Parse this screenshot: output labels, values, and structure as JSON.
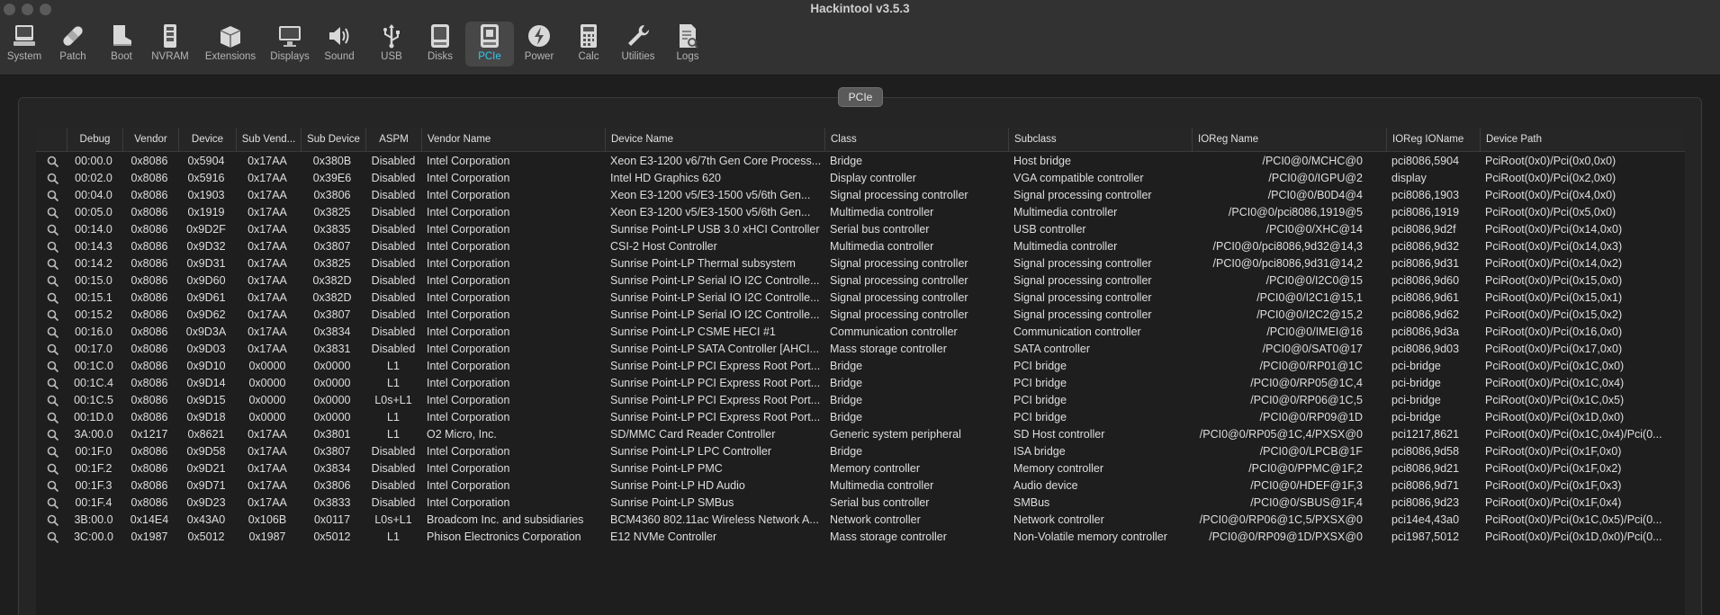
{
  "window": {
    "title": "Hackintool v3.5.3"
  },
  "toolbar": {
    "items": [
      {
        "id": "system",
        "label": "System",
        "icon": "computer-icon"
      },
      {
        "id": "patch",
        "label": "Patch",
        "icon": "bandage-icon"
      },
      {
        "id": "boot",
        "label": "Boot",
        "icon": "boot-icon"
      },
      {
        "id": "nvram",
        "label": "NVRAM",
        "icon": "memory-chip-icon"
      },
      {
        "id": "extensions",
        "label": "Extensions",
        "icon": "box-icon"
      },
      {
        "id": "displays",
        "label": "Displays",
        "icon": "display-icon"
      },
      {
        "id": "sound",
        "label": "Sound",
        "icon": "speaker-icon"
      },
      {
        "id": "usb",
        "label": "USB",
        "icon": "usb-icon"
      },
      {
        "id": "disks",
        "label": "Disks",
        "icon": "disk-icon"
      },
      {
        "id": "pcie",
        "label": "PCIe",
        "icon": "pcie-card-icon",
        "active": true
      },
      {
        "id": "power",
        "label": "Power",
        "icon": "power-bolt-icon"
      },
      {
        "id": "calc",
        "label": "Calc",
        "icon": "calculator-icon"
      },
      {
        "id": "utilities",
        "label": "Utilities",
        "icon": "wrench-icon"
      },
      {
        "id": "logs",
        "label": "Logs",
        "icon": "log-document-icon"
      }
    ]
  },
  "panel": {
    "title": "PCIe"
  },
  "table": {
    "columns": [
      "Debug",
      "Vendor",
      "Device",
      "Sub Vend...",
      "Sub Device",
      "ASPM",
      "Vendor Name",
      "Device Name",
      "Class",
      "Subclass",
      "IOReg Name",
      "IOReg IOName",
      "Device Path"
    ],
    "rows": [
      [
        "00:00.0",
        "0x8086",
        "0x5904",
        "0x17AA",
        "0x380B",
        "Disabled",
        "Intel Corporation",
        "Xeon E3-1200 v6/7th Gen Core Process...",
        "Bridge",
        "Host bridge",
        "/PCI0@0/MCHC@0",
        "pci8086,5904",
        "PciRoot(0x0)/Pci(0x0,0x0)"
      ],
      [
        "00:02.0",
        "0x8086",
        "0x5916",
        "0x17AA",
        "0x39E6",
        "Disabled",
        "Intel Corporation",
        "Intel HD Graphics 620",
        "Display controller",
        "VGA compatible controller",
        "/PCI0@0/IGPU@2",
        "display",
        "PciRoot(0x0)/Pci(0x2,0x0)"
      ],
      [
        "00:04.0",
        "0x8086",
        "0x1903",
        "0x17AA",
        "0x3806",
        "Disabled",
        "Intel Corporation",
        "Xeon E3-1200 v5/E3-1500 v5/6th Gen...",
        "Signal processing controller",
        "Signal processing controller",
        "/PCI0@0/B0D4@4",
        "pci8086,1903",
        "PciRoot(0x0)/Pci(0x4,0x0)"
      ],
      [
        "00:05.0",
        "0x8086",
        "0x1919",
        "0x17AA",
        "0x3825",
        "Disabled",
        "Intel Corporation",
        "Xeon E3-1200 v5/E3-1500 v5/6th Gen...",
        "Multimedia controller",
        "Multimedia controller",
        "/PCI0@0/pci8086,1919@5",
        "pci8086,1919",
        "PciRoot(0x0)/Pci(0x5,0x0)"
      ],
      [
        "00:14.0",
        "0x8086",
        "0x9D2F",
        "0x17AA",
        "0x3835",
        "Disabled",
        "Intel Corporation",
        "Sunrise Point-LP USB 3.0 xHCI Controller",
        "Serial bus controller",
        "USB controller",
        "/PCI0@0/XHC@14",
        "pci8086,9d2f",
        "PciRoot(0x0)/Pci(0x14,0x0)"
      ],
      [
        "00:14.3",
        "0x8086",
        "0x9D32",
        "0x17AA",
        "0x3807",
        "Disabled",
        "Intel Corporation",
        "CSI-2 Host Controller",
        "Multimedia controller",
        "Multimedia controller",
        "/PCI0@0/pci8086,9d32@14,3",
        "pci8086,9d32",
        "PciRoot(0x0)/Pci(0x14,0x3)"
      ],
      [
        "00:14.2",
        "0x8086",
        "0x9D31",
        "0x17AA",
        "0x3825",
        "Disabled",
        "Intel Corporation",
        "Sunrise Point-LP Thermal subsystem",
        "Signal processing controller",
        "Signal processing controller",
        "/PCI0@0/pci8086,9d31@14,2",
        "pci8086,9d31",
        "PciRoot(0x0)/Pci(0x14,0x2)"
      ],
      [
        "00:15.0",
        "0x8086",
        "0x9D60",
        "0x17AA",
        "0x382D",
        "Disabled",
        "Intel Corporation",
        "Sunrise Point-LP Serial IO I2C Controlle...",
        "Signal processing controller",
        "Signal processing controller",
        "/PCI0@0/I2C0@15",
        "pci8086,9d60",
        "PciRoot(0x0)/Pci(0x15,0x0)"
      ],
      [
        "00:15.1",
        "0x8086",
        "0x9D61",
        "0x17AA",
        "0x382D",
        "Disabled",
        "Intel Corporation",
        "Sunrise Point-LP Serial IO I2C Controlle...",
        "Signal processing controller",
        "Signal processing controller",
        "/PCI0@0/I2C1@15,1",
        "pci8086,9d61",
        "PciRoot(0x0)/Pci(0x15,0x1)"
      ],
      [
        "00:15.2",
        "0x8086",
        "0x9D62",
        "0x17AA",
        "0x3807",
        "Disabled",
        "Intel Corporation",
        "Sunrise Point-LP Serial IO I2C Controlle...",
        "Signal processing controller",
        "Signal processing controller",
        "/PCI0@0/I2C2@15,2",
        "pci8086,9d62",
        "PciRoot(0x0)/Pci(0x15,0x2)"
      ],
      [
        "00:16.0",
        "0x8086",
        "0x9D3A",
        "0x17AA",
        "0x3834",
        "Disabled",
        "Intel Corporation",
        "Sunrise Point-LP CSME HECI #1",
        "Communication controller",
        "Communication controller",
        "/PCI0@0/IMEI@16",
        "pci8086,9d3a",
        "PciRoot(0x0)/Pci(0x16,0x0)"
      ],
      [
        "00:17.0",
        "0x8086",
        "0x9D03",
        "0x17AA",
        "0x3831",
        "Disabled",
        "Intel Corporation",
        "Sunrise Point-LP SATA Controller [AHCI...",
        "Mass storage controller",
        "SATA controller",
        "/PCI0@0/SAT0@17",
        "pci8086,9d03",
        "PciRoot(0x0)/Pci(0x17,0x0)"
      ],
      [
        "00:1C.0",
        "0x8086",
        "0x9D10",
        "0x0000",
        "0x0000",
        "L1",
        "Intel Corporation",
        "Sunrise Point-LP PCI Express Root Port...",
        "Bridge",
        "PCI bridge",
        "/PCI0@0/RP01@1C",
        "pci-bridge",
        "PciRoot(0x0)/Pci(0x1C,0x0)"
      ],
      [
        "00:1C.4",
        "0x8086",
        "0x9D14",
        "0x0000",
        "0x0000",
        "L1",
        "Intel Corporation",
        "Sunrise Point-LP PCI Express Root Port...",
        "Bridge",
        "PCI bridge",
        "/PCI0@0/RP05@1C,4",
        "pci-bridge",
        "PciRoot(0x0)/Pci(0x1C,0x4)"
      ],
      [
        "00:1C.5",
        "0x8086",
        "0x9D15",
        "0x0000",
        "0x0000",
        "L0s+L1",
        "Intel Corporation",
        "Sunrise Point-LP PCI Express Root Port...",
        "Bridge",
        "PCI bridge",
        "/PCI0@0/RP06@1C,5",
        "pci-bridge",
        "PciRoot(0x0)/Pci(0x1C,0x5)"
      ],
      [
        "00:1D.0",
        "0x8086",
        "0x9D18",
        "0x0000",
        "0x0000",
        "L1",
        "Intel Corporation",
        "Sunrise Point-LP PCI Express Root Port...",
        "Bridge",
        "PCI bridge",
        "/PCI0@0/RP09@1D",
        "pci-bridge",
        "PciRoot(0x0)/Pci(0x1D,0x0)"
      ],
      [
        "3A:00.0",
        "0x1217",
        "0x8621",
        "0x17AA",
        "0x3801",
        "L1",
        "O2 Micro, Inc.",
        "SD/MMC Card Reader Controller",
        "Generic system peripheral",
        "SD Host controller",
        "/PCI0@0/RP05@1C,4/PXSX@0",
        "pci1217,8621",
        "PciRoot(0x0)/Pci(0x1C,0x4)/Pci(0..."
      ],
      [
        "00:1F.0",
        "0x8086",
        "0x9D58",
        "0x17AA",
        "0x3807",
        "Disabled",
        "Intel Corporation",
        "Sunrise Point-LP LPC Controller",
        "Bridge",
        "ISA bridge",
        "/PCI0@0/LPCB@1F",
        "pci8086,9d58",
        "PciRoot(0x0)/Pci(0x1F,0x0)"
      ],
      [
        "00:1F.2",
        "0x8086",
        "0x9D21",
        "0x17AA",
        "0x3834",
        "Disabled",
        "Intel Corporation",
        "Sunrise Point-LP PMC",
        "Memory controller",
        "Memory controller",
        "/PCI0@0/PPMC@1F,2",
        "pci8086,9d21",
        "PciRoot(0x0)/Pci(0x1F,0x2)"
      ],
      [
        "00:1F.3",
        "0x8086",
        "0x9D71",
        "0x17AA",
        "0x3806",
        "Disabled",
        "Intel Corporation",
        "Sunrise Point-LP HD Audio",
        "Multimedia controller",
        "Audio device",
        "/PCI0@0/HDEF@1F,3",
        "pci8086,9d71",
        "PciRoot(0x0)/Pci(0x1F,0x3)"
      ],
      [
        "00:1F.4",
        "0x8086",
        "0x9D23",
        "0x17AA",
        "0x3833",
        "Disabled",
        "Intel Corporation",
        "Sunrise Point-LP SMBus",
        "Serial bus controller",
        "SMBus",
        "/PCI0@0/SBUS@1F,4",
        "pci8086,9d23",
        "PciRoot(0x0)/Pci(0x1F,0x4)"
      ],
      [
        "3B:00.0",
        "0x14E4",
        "0x43A0",
        "0x106B",
        "0x0117",
        "L0s+L1",
        "Broadcom Inc. and subsidiaries",
        "BCM4360 802.11ac Wireless Network A...",
        "Network controller",
        "Network controller",
        "/PCI0@0/RP06@1C,5/PXSX@0",
        "pci14e4,43a0",
        "PciRoot(0x0)/Pci(0x1C,0x5)/Pci(0..."
      ],
      [
        "3C:00.0",
        "0x1987",
        "0x5012",
        "0x1987",
        "0x5012",
        "L1",
        "Phison Electronics Corporation",
        "E12 NVMe Controller",
        "Mass storage controller",
        "Non-Volatile memory controller",
        "/PCI0@0/RP09@1D/PXSX@0",
        "pci1987,5012",
        "PciRoot(0x0)/Pci(0x1D,0x0)/Pci(0..."
      ]
    ]
  }
}
